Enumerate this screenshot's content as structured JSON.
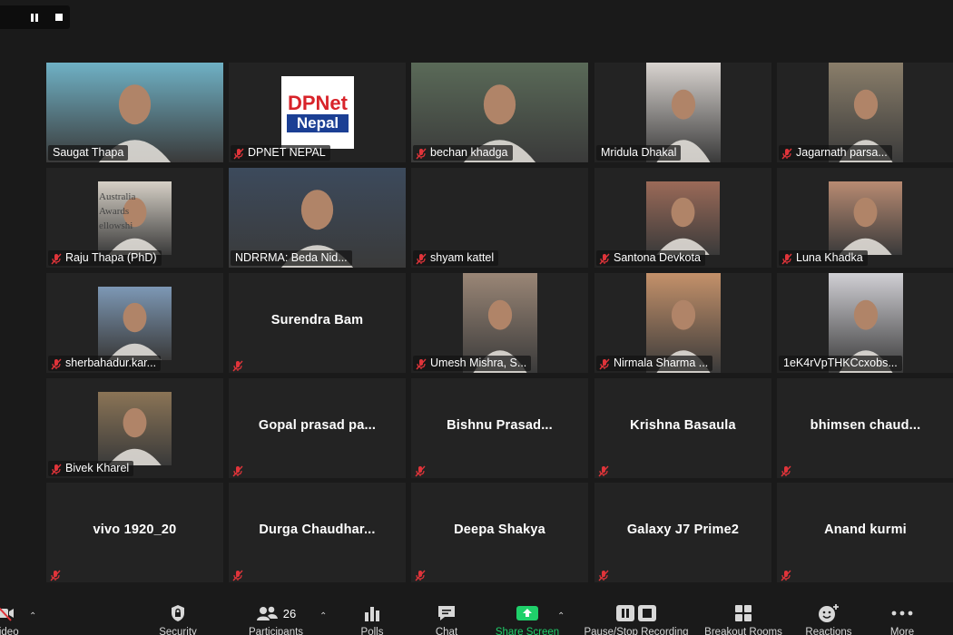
{
  "recording": {
    "pause_icon": "pause-icon",
    "stop_icon": "stop-icon"
  },
  "participants": [
    {
      "name": "Saugat Thapa",
      "muted": false,
      "video": "full",
      "active": false,
      "color": "#6fb1c5"
    },
    {
      "name": "DPNET NEPAL",
      "muted": true,
      "video": "logo",
      "active": false,
      "logo_text_1": "DPNet",
      "logo_text_2": "Nepal"
    },
    {
      "name": "bechan khadga",
      "muted": true,
      "video": "full",
      "active": false,
      "color": "#5a6a58"
    },
    {
      "name": "Mridula Dhakal",
      "muted": false,
      "video": "center-wide",
      "active": false,
      "color": "#d9d4d0"
    },
    {
      "name": "Jagarnath parsa...",
      "muted": true,
      "video": "center-wide",
      "active": false,
      "color": "#8a7e6a"
    },
    {
      "name": "Raju Thapa (PhD)",
      "muted": true,
      "video": "center",
      "active": false,
      "color": "#d6d0c6"
    },
    {
      "name": "NDRRMA: Beda Nid...",
      "muted": false,
      "video": "full",
      "active": true,
      "color": "#3c4a5c"
    },
    {
      "name": "shyam kattel",
      "muted": true,
      "video": "none",
      "active": false
    },
    {
      "name": "Santona Devkota",
      "muted": true,
      "video": "center",
      "active": false,
      "color": "#9b6a58"
    },
    {
      "name": "Luna Khadka",
      "muted": true,
      "video": "center",
      "active": false,
      "color": "#b88b72"
    },
    {
      "name": "sherbahadur.kar...",
      "muted": true,
      "video": "center",
      "active": false,
      "color": "#7d98b5"
    },
    {
      "name": "Surendra Bam",
      "muted": true,
      "video": "none-big",
      "active": false
    },
    {
      "name": "Umesh Mishra, S...",
      "muted": true,
      "video": "center-wide",
      "active": false,
      "color": "#9a8676"
    },
    {
      "name": "Nirmala Sharma ...",
      "muted": true,
      "video": "center-wide",
      "active": false,
      "color": "#c4916a"
    },
    {
      "name": "1eK4rVpTHKCcxobs...",
      "muted": false,
      "video": "center-wide",
      "active": false,
      "color": "#d0cfd4"
    },
    {
      "name": "Bivek Kharel",
      "muted": true,
      "video": "center",
      "active": false,
      "color": "#8b7456"
    },
    {
      "name": "Gopal  prasad  pa...",
      "muted": true,
      "video": "none-big",
      "active": false
    },
    {
      "name": "Bishnu  Prasad...",
      "muted": true,
      "video": "none-big",
      "active": false
    },
    {
      "name": "Krishna Basaula",
      "muted": true,
      "video": "none-big",
      "active": false
    },
    {
      "name": "bhimsen  chaud...",
      "muted": true,
      "video": "none-big",
      "active": false
    },
    {
      "name": "vivo 1920_20",
      "muted": true,
      "video": "none-big",
      "active": false
    },
    {
      "name": "Durga  Chaudhar...",
      "muted": true,
      "video": "none-big",
      "active": false
    },
    {
      "name": "Deepa Shakya",
      "muted": true,
      "video": "none-big",
      "active": false
    },
    {
      "name": "Galaxy J7 Prime2",
      "muted": true,
      "video": "none-big",
      "active": false
    },
    {
      "name": "Anand kurmi",
      "muted": true,
      "video": "none-big",
      "active": false
    }
  ],
  "raju_photo_text": [
    "Australia",
    "Awards",
    "ellowshi"
  ],
  "toolbar": {
    "video_label": "Video",
    "security_label": "Security",
    "participants_label": "Participants",
    "participants_count": "26",
    "polls_label": "Polls",
    "chat_label": "Chat",
    "share_label": "Share Screen",
    "record_label": "Pause/Stop Recording",
    "breakout_label": "Breakout Rooms",
    "reactions_label": "Reactions",
    "more_label": "More",
    "share_color": "#1fd06a"
  }
}
